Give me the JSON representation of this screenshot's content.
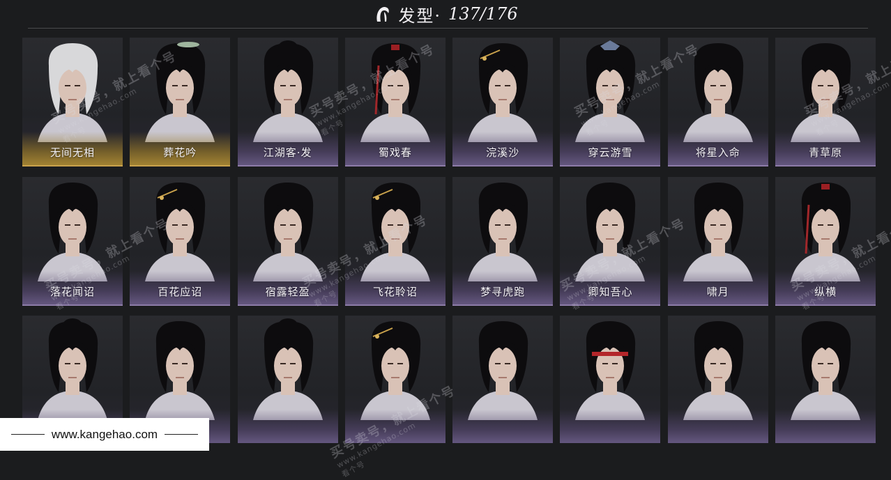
{
  "header": {
    "icon": "hair-icon",
    "title": "发型·",
    "count": "137/176"
  },
  "hairstyles": [
    {
      "label": "无间无相",
      "frame": "gold",
      "hair": "white"
    },
    {
      "label": "葬花吟",
      "frame": "gold",
      "hair": "black-ornament"
    },
    {
      "label": "江湖客·发",
      "frame": "purple",
      "hair": "black-bun"
    },
    {
      "label": "蜀戏春",
      "frame": "purple",
      "hair": "black-red"
    },
    {
      "label": "浣溪沙",
      "frame": "purple",
      "hair": "black-pin"
    },
    {
      "label": "穿云游雪",
      "frame": "purple",
      "hair": "black-crown"
    },
    {
      "label": "将星入命",
      "frame": "purple",
      "hair": "black-wavy"
    },
    {
      "label": "青草原",
      "frame": "purple",
      "hair": "black-short"
    },
    {
      "label": "落花闻诏",
      "frame": "purple",
      "hair": "black-wavy"
    },
    {
      "label": "百花应诏",
      "frame": "purple",
      "hair": "black-pin"
    },
    {
      "label": "宿露轻盈",
      "frame": "purple",
      "hair": "black-wavy"
    },
    {
      "label": "飞花聆诏",
      "frame": "purple",
      "hair": "black-pin"
    },
    {
      "label": "梦寻虎跑",
      "frame": "purple",
      "hair": "black-spiky"
    },
    {
      "label": "卿知吾心",
      "frame": "purple",
      "hair": "black-wavy"
    },
    {
      "label": "啸月",
      "frame": "purple",
      "hair": "black-spiky"
    },
    {
      "label": "纵横",
      "frame": "purple",
      "hair": "black-red"
    },
    {
      "label": "",
      "frame": "none",
      "hair": "black-bun"
    },
    {
      "label": "",
      "frame": "none",
      "hair": "black-wavy"
    },
    {
      "label": "",
      "frame": "none",
      "hair": "black-bun"
    },
    {
      "label": "",
      "frame": "none",
      "hair": "black-pin"
    },
    {
      "label": "",
      "frame": "none",
      "hair": "black-long"
    },
    {
      "label": "",
      "frame": "none",
      "hair": "black-headband"
    },
    {
      "label": "",
      "frame": "none",
      "hair": "black-wavy"
    },
    {
      "label": "",
      "frame": "none",
      "hair": "black-short"
    }
  ],
  "watermarks": [
    {
      "text": "买号卖号，就上看个号",
      "site": "www.kangehao.com",
      "sub": "看个号"
    },
    {
      "text": "买号卖号，就上看个号",
      "site": "www.kangehao.com",
      "sub": "看个号"
    },
    {
      "text": "买号卖号，就上看个号",
      "site": "www.kangehao.com",
      "sub": "看个号"
    },
    {
      "text": "买号卖号，就上看个号",
      "site": "www.kangehao.com",
      "sub": "看个号"
    },
    {
      "text": "买号卖号，就上看个号",
      "site": "www.kangehao.com",
      "sub": "看个号"
    },
    {
      "text": "买号卖号，就上看个号",
      "site": "www.kangehao.com",
      "sub": "看个号"
    },
    {
      "text": "买号卖号，就上看个号",
      "site": "www.kangehao.com",
      "sub": "看个号"
    },
    {
      "text": "买号卖号，就上看个号",
      "site": "www.kangehao.com",
      "sub": "看个号"
    },
    {
      "text": "买号卖号，就上看个号",
      "site": "www.kangehao.com",
      "sub": "看个号"
    }
  ],
  "footer": {
    "url": "www.kangehao.com"
  }
}
